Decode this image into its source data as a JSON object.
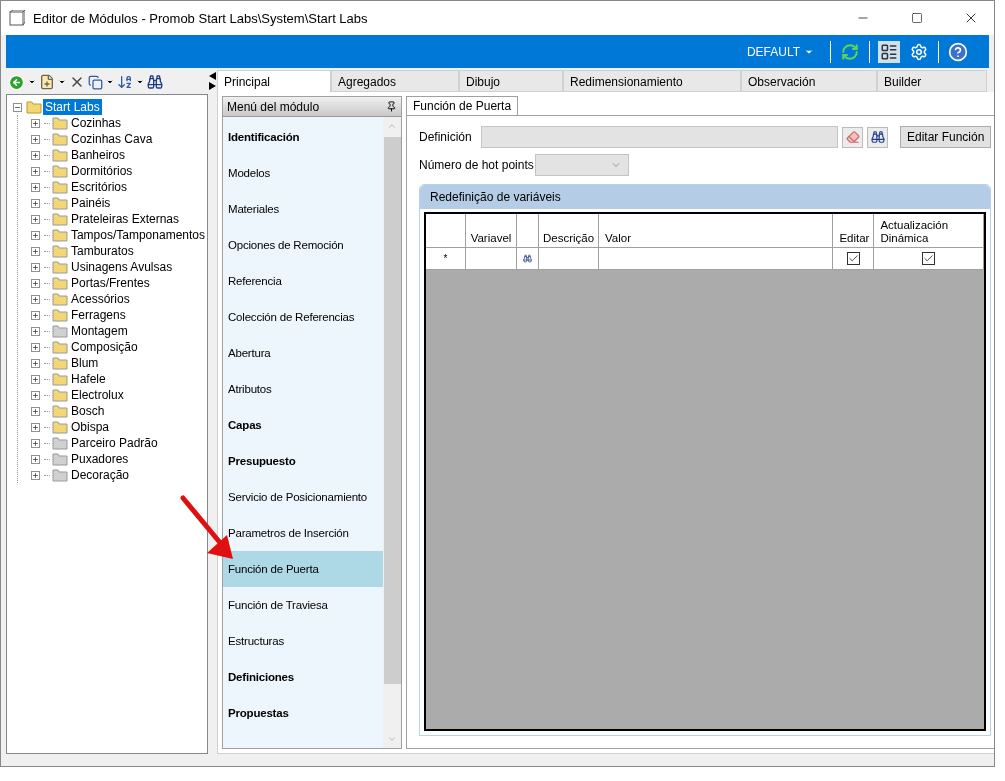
{
  "window": {
    "title": "Editor de Módulos - Promob Start Labs\\System\\Start Labs"
  },
  "ribbon": {
    "profile": "DEFAULT"
  },
  "tree": {
    "label": "Start Labs",
    "selected": true,
    "expanded": true,
    "color": "#f3d675",
    "children": [
      {
        "label": "Cozinhas",
        "color": "#f3d675"
      },
      {
        "label": "Cozinhas Cava",
        "color": "#f3d675"
      },
      {
        "label": "Banheiros",
        "color": "#f3d675"
      },
      {
        "label": "Dormitórios",
        "color": "#f3d675"
      },
      {
        "label": "Escritórios",
        "color": "#f3d675"
      },
      {
        "label": "Painéis",
        "color": "#f3d675"
      },
      {
        "label": "Prateleiras Externas",
        "color": "#f3d675"
      },
      {
        "label": "Tampos/Tamponamentos",
        "color": "#f3d675"
      },
      {
        "label": "Tamburatos",
        "color": "#f3d675"
      },
      {
        "label": "Usinagens Avulsas",
        "color": "#f3d675"
      },
      {
        "label": "Portas/Frentes",
        "color": "#f3d675"
      },
      {
        "label": "Acessórios",
        "color": "#f3d675"
      },
      {
        "label": "Ferragens",
        "color": "#f3d675"
      },
      {
        "label": "Montagem",
        "color": "#d0d0d0"
      },
      {
        "label": "Composição",
        "color": "#f3d675"
      },
      {
        "label": "Blum",
        "color": "#f3d675"
      },
      {
        "label": "Hafele",
        "color": "#f3d675"
      },
      {
        "label": "Electrolux",
        "color": "#f3d675"
      },
      {
        "label": "Bosch",
        "color": "#f3d675"
      },
      {
        "label": "Obispa",
        "color": "#f3d675"
      },
      {
        "label": "Parceiro Padrão",
        "color": "#d0d0d0"
      },
      {
        "label": "Puxadores",
        "color": "#d0d0d0"
      },
      {
        "label": "Decoração",
        "color": "#d0d0d0"
      }
    ]
  },
  "tabs": [
    {
      "label": "Principal",
      "selected": true
    },
    {
      "label": "Agregados",
      "selected": false
    },
    {
      "label": "Dibujo",
      "selected": false
    },
    {
      "label": "Redimensionamiento",
      "selected": false
    },
    {
      "label": "Observación",
      "selected": false
    },
    {
      "label": "Builder",
      "selected": false
    }
  ],
  "module_menu": {
    "title": "Menú del módulo",
    "items": [
      {
        "label": "Identificación",
        "kind": "heading",
        "selected": false
      },
      {
        "label": "Modelos",
        "kind": "item",
        "selected": false
      },
      {
        "label": "Materiales",
        "kind": "item",
        "selected": false
      },
      {
        "label": "Opciones de Remoción",
        "kind": "item",
        "selected": false
      },
      {
        "label": "Referencia",
        "kind": "item",
        "selected": false
      },
      {
        "label": "Colección de Referencias",
        "kind": "item",
        "selected": false
      },
      {
        "label": "Abertura",
        "kind": "item",
        "selected": false
      },
      {
        "label": "Atributos",
        "kind": "item",
        "selected": false
      },
      {
        "label": "Capas",
        "kind": "heading",
        "selected": false
      },
      {
        "label": "Presupuesto",
        "kind": "heading",
        "selected": false
      },
      {
        "label": "Servicio de Posicionamiento",
        "kind": "item",
        "selected": false
      },
      {
        "label": "Parametros de Inserción",
        "kind": "item",
        "selected": false
      },
      {
        "label": "Función de Puerta",
        "kind": "item",
        "selected": true
      },
      {
        "label": "Función de Traviesa",
        "kind": "item",
        "selected": false
      },
      {
        "label": "Estructuras",
        "kind": "item",
        "selected": false
      },
      {
        "label": "Definiciones",
        "kind": "heading",
        "selected": false
      },
      {
        "label": "Propuestas",
        "kind": "heading",
        "selected": false
      }
    ]
  },
  "sub_tabs": [
    {
      "label": "Función de Puerta",
      "selected": true
    }
  ],
  "form": {
    "definition_label": "Definición",
    "edit_button": "Editar Función",
    "hot_points_label": "Número de hot points",
    "group": {
      "title": "Redefinição de variáveis",
      "columns": [
        {
          "kind": "text",
          "label": "Variavel"
        },
        {
          "kind": "icon"
        },
        {
          "kind": "text",
          "label": "Descrição"
        },
        {
          "kind": "text",
          "label": "Valor"
        },
        {
          "kind": "check",
          "label": "Editar"
        },
        {
          "kind": "check",
          "label": "Actualización Dinámica"
        }
      ],
      "new_row": {
        "marker": "*",
        "editar": true,
        "dynamic": true
      }
    }
  }
}
